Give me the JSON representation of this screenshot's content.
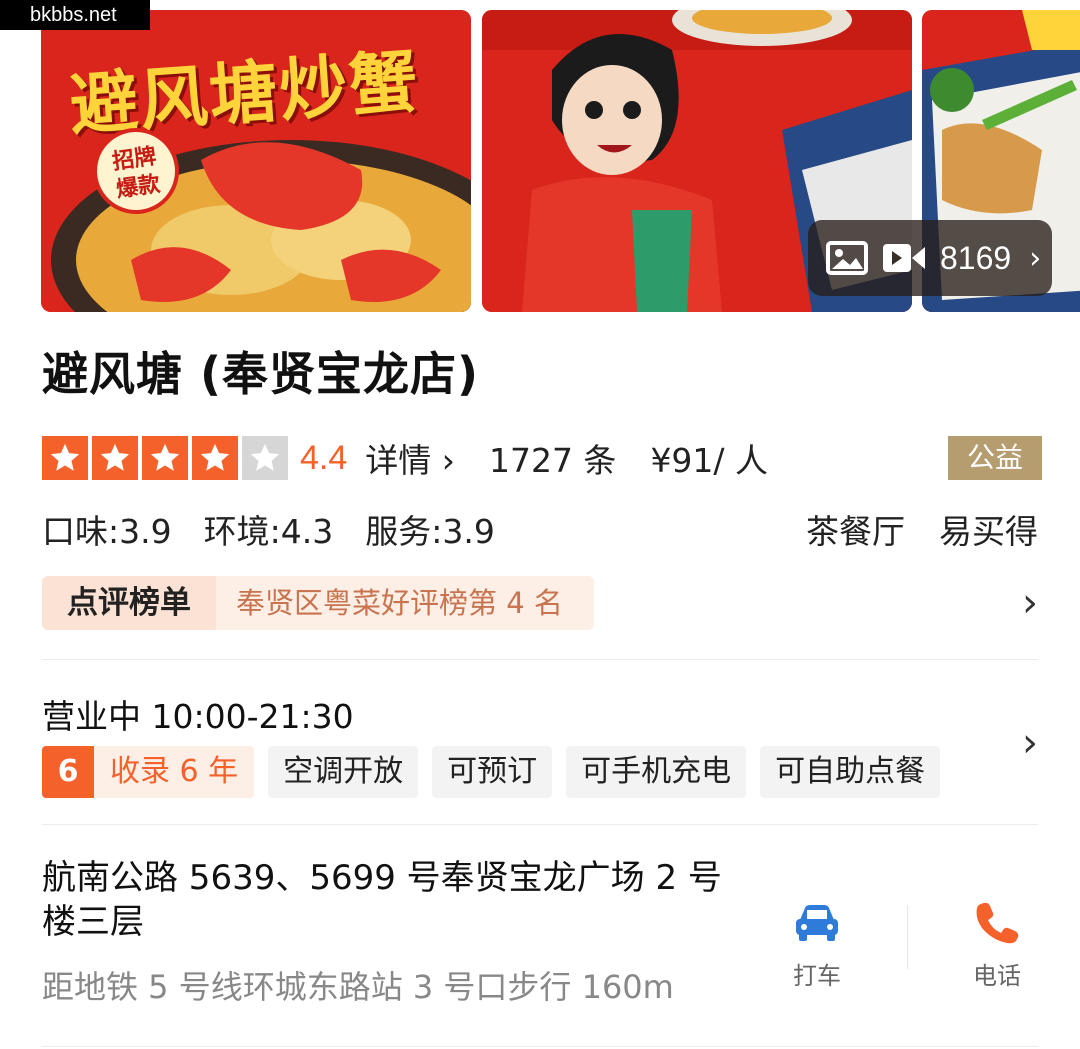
{
  "watermark": "bkbbs.net",
  "gallery": {
    "poster_title": "避风塘炒蟹",
    "poster_badge_line1": "招牌",
    "poster_badge_line2": "爆款",
    "media_count": "8169",
    "media_icons": [
      "image-icon",
      "video-icon",
      "chevron-right-icon"
    ]
  },
  "shop": {
    "name": "避风塘 (奉贤宝龙店)",
    "rating": 4.4,
    "rating_text": "4.4",
    "stars_filled": 4,
    "stars_total": 5,
    "detail_link": "详情 ›",
    "review_count": "1727 条",
    "price": "¥91/ 人",
    "charity_badge": "公益",
    "sub_scores": {
      "taste": "口味:3.9",
      "environment": "环境:4.3",
      "service": "服务:3.9"
    },
    "categories": [
      "茶餐厅",
      "易买得"
    ],
    "ranking": {
      "label": "点评榜单",
      "text": "奉贤区粤菜好评榜第 4 名"
    },
    "hours": "营业中 10:00-21:30",
    "tags": {
      "years_number": "6",
      "years_text": "收录 6 年",
      "items": [
        "空调开放",
        "可预订",
        "可手机充电",
        "可自助点餐"
      ]
    },
    "address_line1": "航南公路 5639、5699 号奉贤宝龙广场 2 号",
    "address_line2": "楼三层",
    "subway": "距地铁 5 号线环城东路站 3 号口步行 160m"
  },
  "actions": {
    "taxi_label": "打车",
    "phone_label": "电话"
  },
  "colors": {
    "accent_orange": "#f5612b",
    "charity_gold": "#b59d70",
    "taxi_blue": "#2f7bd9",
    "phone_orange": "#f5612b"
  }
}
